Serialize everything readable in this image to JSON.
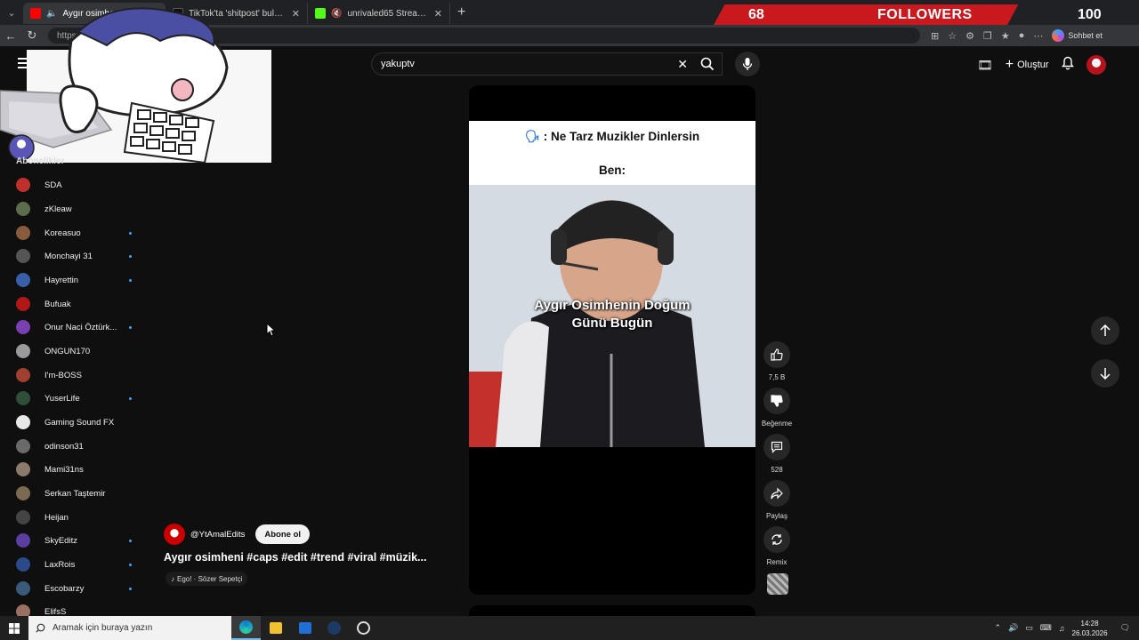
{
  "browser": {
    "tabs": [
      {
        "title": "Aygır osimheni #caps #edit #trend #viral #müzik - YouTube",
        "active": true,
        "favicon_color": "#ff0000"
      },
      {
        "title": "TikTok'ta 'shitpost' bulabilirsiniz | TikTok",
        "active": false,
        "favicon_color": "#111111"
      },
      {
        "title": "unrivaled65 Stream - Kick Dashboard",
        "active": false,
        "favicon_color": "#53fc18"
      }
    ],
    "address_url": "https://...N2kHudV08",
    "sohbet_label": "Sohbet et"
  },
  "stream_overlay": {
    "followers_count": "68",
    "followers_label": "FOLLOWERS",
    "followers_goal": "100"
  },
  "youtube": {
    "search_value": "yakuptv",
    "create_label": "Oluştur",
    "sidebar": {
      "section_title": "Abonelikler",
      "channels": [
        {
          "name": "SDA",
          "color": "#c0302b",
          "new": false
        },
        {
          "name": "zKleaw",
          "color": "#5b6d4a",
          "new": false
        },
        {
          "name": "Koreasuo",
          "color": "#8a5a3c",
          "new": true
        },
        {
          "name": "Monchayi 31",
          "color": "#555555",
          "new": true
        },
        {
          "name": "Hayrettin",
          "color": "#3a5ea8",
          "new": true
        },
        {
          "name": "Bufuak",
          "color": "#b01818",
          "new": false
        },
        {
          "name": "Onur Naci Öztürk...",
          "color": "#7a3fb0",
          "new": true
        },
        {
          "name": "ONGUN170",
          "color": "#9a9a9a",
          "new": false
        },
        {
          "name": "I'm-BOSS",
          "color": "#a04030",
          "new": false
        },
        {
          "name": "YuserLife",
          "color": "#2e4f38",
          "new": true
        },
        {
          "name": "Gaming Sound FX",
          "color": "#e8e8e8",
          "new": false
        },
        {
          "name": "odinson31",
          "color": "#6a6a6a",
          "new": false
        },
        {
          "name": "Mami31ns",
          "color": "#8c7a6a",
          "new": false
        },
        {
          "name": "Serkan Taştemir",
          "color": "#7a6a50",
          "new": false
        },
        {
          "name": "Heijan",
          "color": "#444444",
          "new": false
        },
        {
          "name": "SkyEditz",
          "color": "#5a3fa0",
          "new": true
        },
        {
          "name": "LaxRois",
          "color": "#2a4a8a",
          "new": true
        },
        {
          "name": "Escobarzy",
          "color": "#3a5a7a",
          "new": true
        },
        {
          "name": "ElifsS",
          "color": "#9a7060",
          "new": false
        }
      ]
    },
    "short": {
      "question": ": Ne Tarz Muzikler Dinlersin",
      "answer": "Ben:",
      "overlay_line1": "Aygır Osimhenin Doğum",
      "overlay_line2": "Günü Bugün",
      "channel_handle": "@YtAmalEdits",
      "subscribe_label": "Abone ol",
      "title": "Aygır osimheni #caps #edit #trend #viral #müzik...",
      "music": "Ego! · Sözer Sepetçi"
    },
    "actions": {
      "like_count": "7,5 B",
      "dislike_label": "Beğenme",
      "comment_count": "528",
      "share_label": "Paylaş",
      "remix_label": "Remix"
    }
  },
  "taskbar": {
    "search_placeholder": "Aramak için buraya yazın",
    "time": "14:28",
    "date": "26.03.2026"
  }
}
